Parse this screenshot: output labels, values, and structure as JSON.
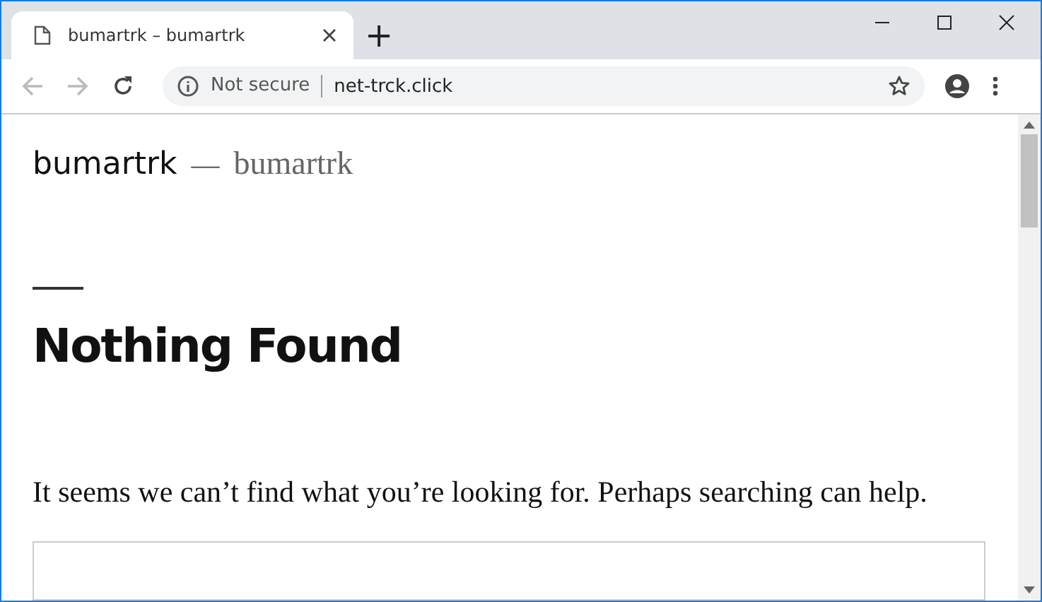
{
  "tabs": [
    {
      "title": "bumartrk – bumartrk",
      "selected": true
    }
  ],
  "new_tab": "+",
  "address_bar": {
    "security": "Not secure",
    "url": "net-trck.click"
  },
  "page": {
    "site_title": "bumartrk",
    "separator": "—",
    "site_description": "bumartrk",
    "heading": "Nothing Found",
    "message": "It seems we can’t find what you’re looking for. Perhaps searching can help."
  }
}
